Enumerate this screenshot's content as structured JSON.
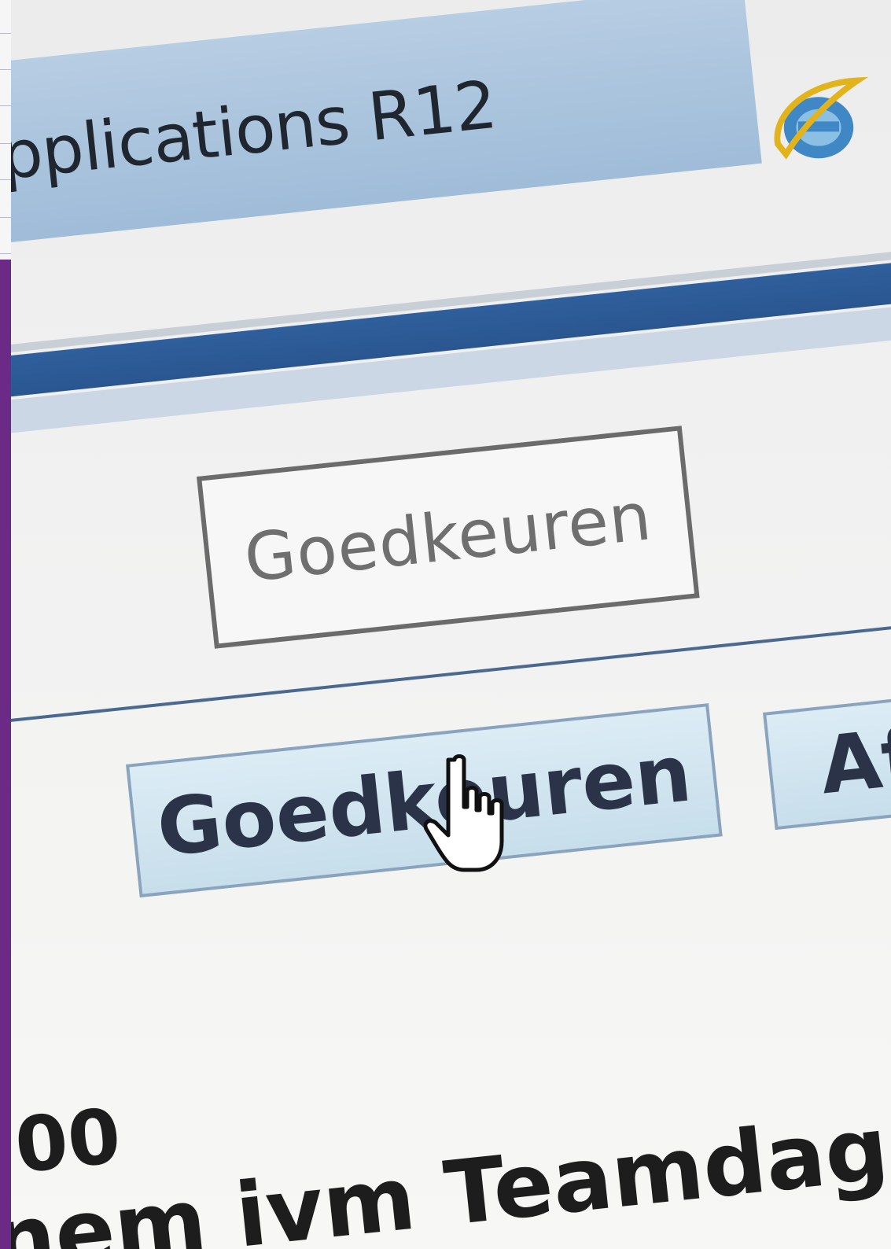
{
  "browser": {
    "tab_title": "pplications R12",
    "icon": "internet-explorer-icon"
  },
  "action_panel": {
    "approve_label_outline": "Goedkeuren",
    "approve_label": "Goedkeuren",
    "next_button_label": "Af"
  },
  "cursor": {
    "icon": "hand-pointer-icon"
  },
  "record": {
    "amount_fragment": "00",
    "description_fragment": "nem ivm Teamdag TVM"
  }
}
